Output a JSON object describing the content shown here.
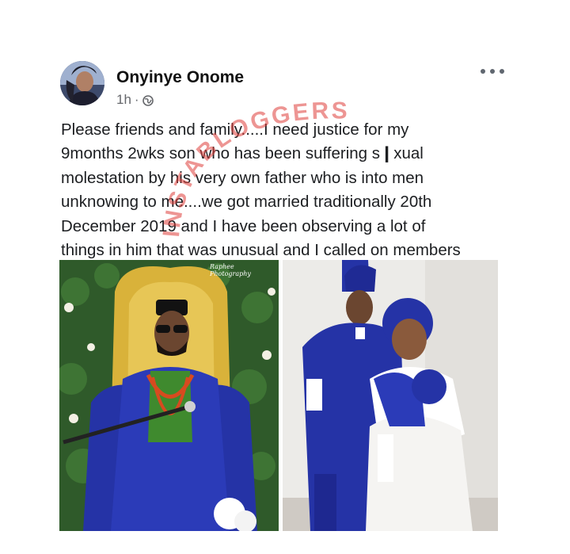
{
  "post": {
    "author": "Onyinye Onome",
    "time": "1h",
    "separator": "·",
    "audience_icon": "globe-icon",
    "more_icon": "more-options-icon",
    "text_lines": [
      "Please friends and family.....I need justice for my",
      "9months 2wks son who has been suffering s❙xual",
      "molestation by his very own father who is into men",
      "unknowing to me....we got married traditionally 20th",
      "December 2019 and I have been observing a lot of",
      "things in him that was unusual and I called on members"
    ]
  },
  "watermark": {
    "text": "INSTABLOGGERS"
  },
  "photos": {
    "left_caption_1": "Raphee",
    "left_caption_2": "Photography"
  },
  "colors": {
    "name": "#111111",
    "meta": "#65676b",
    "text": "#1c1e21",
    "watermark": "#e0403c",
    "agbada_blue": "#2533a6",
    "hedge_green": "#2f5a2a",
    "throne_gold": "#d9b23a"
  }
}
